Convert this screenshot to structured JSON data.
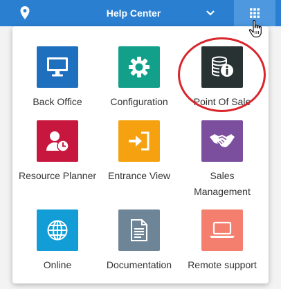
{
  "header": {
    "title": "Help Center",
    "icons": [
      "location-pin-icon",
      "chevron-down-icon",
      "apps-grid-icon",
      "hand-pointer-cursor"
    ],
    "colors": {
      "bar": "#2a7fd1",
      "active_button": "#4d98de"
    }
  },
  "apps": [
    {
      "label": "Back Office",
      "icon": "monitor-icon",
      "color": "#1f6fbf"
    },
    {
      "label": "Configuration",
      "icon": "gear-icon",
      "color": "#12a08a"
    },
    {
      "label": "Point Of Sale",
      "icon": "coins-info-icon",
      "color": "#293233"
    },
    {
      "label": "Resource Planner",
      "icon": "person-clock-icon",
      "color": "#c8173e"
    },
    {
      "label": "Entrance View",
      "icon": "sign-in-icon",
      "color": "#f5a110"
    },
    {
      "label": "Sales Management",
      "icon": "handshake-icon",
      "color": "#7b4f9e"
    },
    {
      "label": "Online",
      "icon": "globe-icon",
      "color": "#139dd7"
    },
    {
      "label": "Documentation",
      "icon": "document-icon",
      "color": "#6e8597"
    },
    {
      "label": "Remote support",
      "icon": "laptop-icon",
      "color": "#f57f6e"
    }
  ],
  "annotation": {
    "color": "#d9252b",
    "highlighted": "Point Of Sale"
  }
}
